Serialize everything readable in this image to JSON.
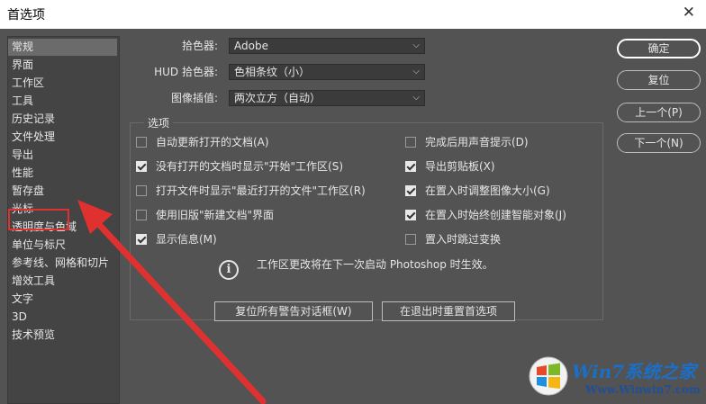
{
  "window": {
    "title": "首选项"
  },
  "sidebar": {
    "items": [
      {
        "label": "常规",
        "selected": true
      },
      {
        "label": "界面"
      },
      {
        "label": "工作区"
      },
      {
        "label": "工具"
      },
      {
        "label": "历史记录"
      },
      {
        "label": "文件处理"
      },
      {
        "label": "导出"
      },
      {
        "label": "性能"
      },
      {
        "label": "暂存盘",
        "highlighted": true
      },
      {
        "label": "光标"
      },
      {
        "label": "透明度与色域"
      },
      {
        "label": "单位与标尺"
      },
      {
        "label": "参考线、网格和切片"
      },
      {
        "label": "增效工具"
      },
      {
        "label": "文字"
      },
      {
        "label": "3D"
      },
      {
        "label": "技术预览"
      }
    ]
  },
  "settings": {
    "color_picker": {
      "label": "拾色器:",
      "value": "Adobe"
    },
    "hud_color_picker": {
      "label": "HUD 拾色器:",
      "value": "色相条纹（小）"
    },
    "image_interpolation": {
      "label": "图像插值:",
      "value": "两次立方（自动）"
    }
  },
  "options": {
    "title": "选项",
    "left": [
      {
        "label": "自动更新打开的文档(A)",
        "checked": false
      },
      {
        "label": "没有打开的文档时显示\"开始\"工作区(S)",
        "checked": true
      },
      {
        "label": "打开文件时显示\"最近打开的文件\"工作区(R)",
        "checked": false
      },
      {
        "label": "使用旧版\"新建文档\"界面",
        "checked": false
      },
      {
        "label": "显示信息(M)",
        "checked": true
      }
    ],
    "right": [
      {
        "label": "完成后用声音提示(D)",
        "checked": false
      },
      {
        "label": "导出剪贴板(X)",
        "checked": true
      },
      {
        "label": "在置入时调整图像大小(G)",
        "checked": true
      },
      {
        "label": "在置入时始终创建智能对象(J)",
        "checked": true
      },
      {
        "label": "置入时跳过变换",
        "checked": false
      }
    ],
    "info": "工作区更改将在下一次启动 Photoshop 时生效。"
  },
  "bottom_buttons": {
    "reset_warnings": "复位所有警告对话框(W)",
    "reset_on_quit": "在退出时重置首选项"
  },
  "side_buttons": {
    "ok": "确定",
    "reset": "复位",
    "prev": "上一个(P)",
    "next": "下一个(N)"
  },
  "watermark": {
    "brand": "Win7系统之家",
    "url": "Www.Winwin7.com"
  },
  "colors": {
    "panel": "#535353",
    "sidebar": "#444444",
    "highlight": "#e03131"
  }
}
